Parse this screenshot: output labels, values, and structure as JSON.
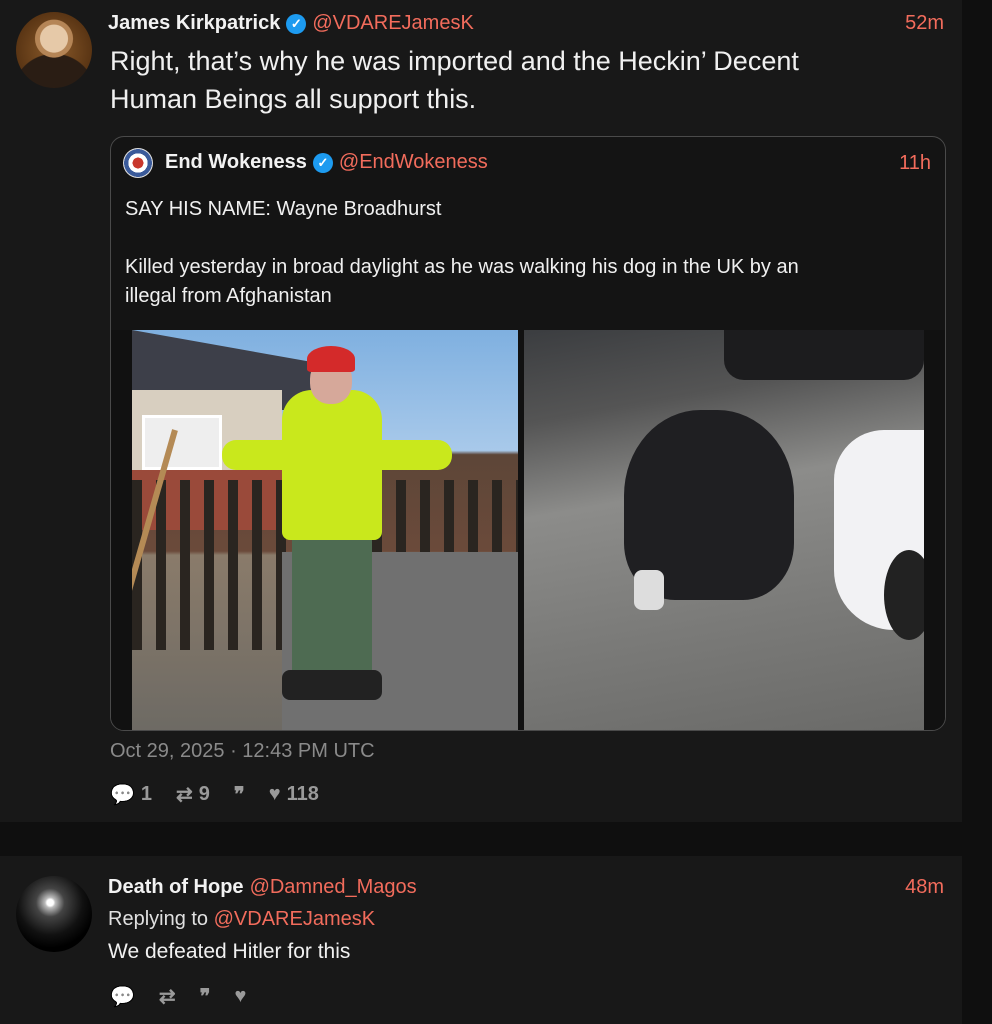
{
  "main_tweet": {
    "name": "James Kirkpatrick",
    "handle": "@VDAREJamesK",
    "time": "52m",
    "text_line1": "Right, that’s why he was imported and the Heckin’ Decent",
    "text_line2": "Human Beings all support this.",
    "date": "Oct 29, 2025 · 12:43 PM UTC",
    "stats": {
      "replies": "1",
      "retweets": "9",
      "likes": "118"
    }
  },
  "quote": {
    "name": "End Wokeness",
    "handle": "@EndWokeness",
    "time": "11h",
    "text": "SAY HIS NAME: Wayne Broadhurst\n\nKilled yesterday in broad daylight as he was walking his dog in the UK by an\nillegal from Afghanistan"
  },
  "reply_tweet": {
    "name": "Death of Hope",
    "handle": "@Damned_Magos",
    "time": "48m",
    "replying_prefix": "Replying to",
    "replying_to": "@VDAREJamesK",
    "text": "We defeated Hitler for this"
  },
  "icons": {
    "verified": "✓",
    "reply": "💬",
    "retweet": "⇄",
    "quote": "❞",
    "like": "♥"
  },
  "colors": {
    "accent": "#f26c5c",
    "verified": "#1d9bf0",
    "background": "#181818"
  }
}
